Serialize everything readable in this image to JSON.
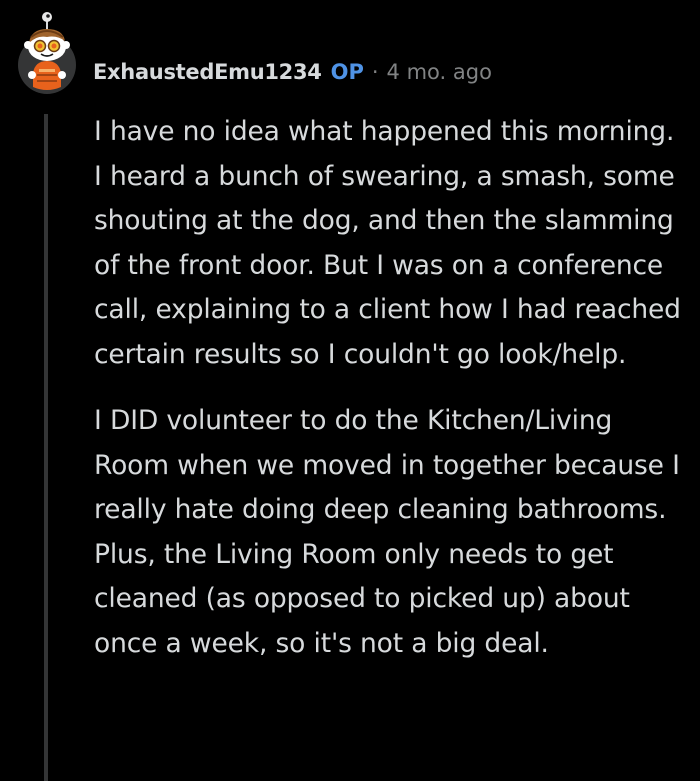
{
  "comment": {
    "author": "ExhaustedEmu1234",
    "op_badge": "OP",
    "separator": "·",
    "timestamp": "4 mo. ago",
    "avatar_icon": "snoo-avatar-icon",
    "paragraphs": [
      "I have no idea what happened this morning. I heard a bunch of swearing, a smash, some shouting at the dog, and then the slamming of the front door. But I was on a conference call, explaining to a client how I had reached certain results so I couldn't go look/help.",
      "I DID volunteer to do the Kitchen/Living Room when we moved in together because I really hate doing deep cleaning bathrooms. Plus, the Living Room only needs to get cleaned (as opposed to picked up) about once a week, so it's not a big deal."
    ]
  },
  "colors": {
    "background": "#000000",
    "text": "#d7dadc",
    "op": "#4f93e6",
    "muted": "#818384",
    "thread_line": "#343536"
  }
}
